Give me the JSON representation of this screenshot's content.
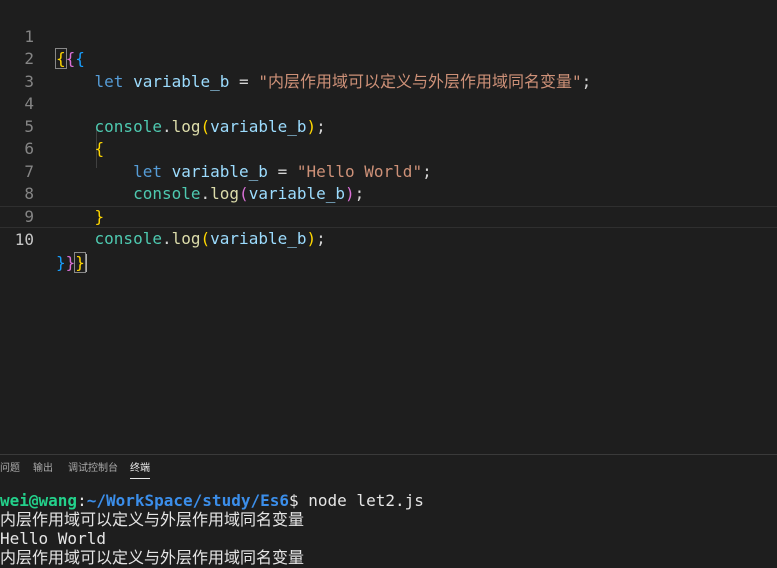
{
  "editor": {
    "lines": [
      {
        "num": "1"
      },
      {
        "num": "2",
        "kw": "let",
        "var": "variable_b",
        "op": " = ",
        "str": "\"内层作用域可以定义与外层作用域同名变量\"",
        "end": ";"
      },
      {
        "num": "3"
      },
      {
        "num": "4",
        "obj": "console",
        "dot": ".",
        "fn": "log",
        "open": "(",
        "arg": "variable_b",
        "close": ")",
        "end": ";"
      },
      {
        "num": "5",
        "brace": "{"
      },
      {
        "num": "6",
        "kw": "let",
        "var": "variable_b",
        "op": " = ",
        "str": "\"Hello World\"",
        "end": ";"
      },
      {
        "num": "7",
        "obj": "console",
        "dot": ".",
        "fn": "log",
        "open": "(",
        "arg": "variable_b",
        "close": ")",
        "end": ";"
      },
      {
        "num": "8",
        "brace": "}"
      },
      {
        "num": "9",
        "obj": "console",
        "dot": ".",
        "fn": "log",
        "open": "(",
        "arg": "variable_b",
        "close": ")",
        "end": ";"
      },
      {
        "num": "10"
      }
    ],
    "line1": {
      "b1": "{",
      "b2": "{",
      "b3": "{"
    },
    "line10": {
      "b1": "}",
      "b2": "}",
      "b3": "}"
    }
  },
  "panel": {
    "tabs": [
      {
        "label": "问题"
      },
      {
        "label": "输出"
      },
      {
        "label": "调试控制台"
      },
      {
        "label": "终端",
        "active": true
      }
    ]
  },
  "terminal": {
    "prompt_user": "wei@wang",
    "prompt_sep": ":",
    "prompt_path": "~/WorkSpace/study/Es6",
    "prompt_dollar": "$ ",
    "command": "node let2.js",
    "output": [
      "内层作用域可以定义与外层作用域同名变量",
      "Hello World",
      "内层作用域可以定义与外层作用域同名变量"
    ]
  },
  "colors": {
    "background": "#1e1e1e",
    "keyword": "#569cd6",
    "variable": "#9cdcfe",
    "string": "#ce9178",
    "function": "#dcdcaa",
    "bracket_level1": "#ffd700",
    "bracket_level2": "#da70d6",
    "bracket_level3": "#179fff",
    "terminal_user": "#23d18b",
    "terminal_path": "#3b8eea"
  }
}
